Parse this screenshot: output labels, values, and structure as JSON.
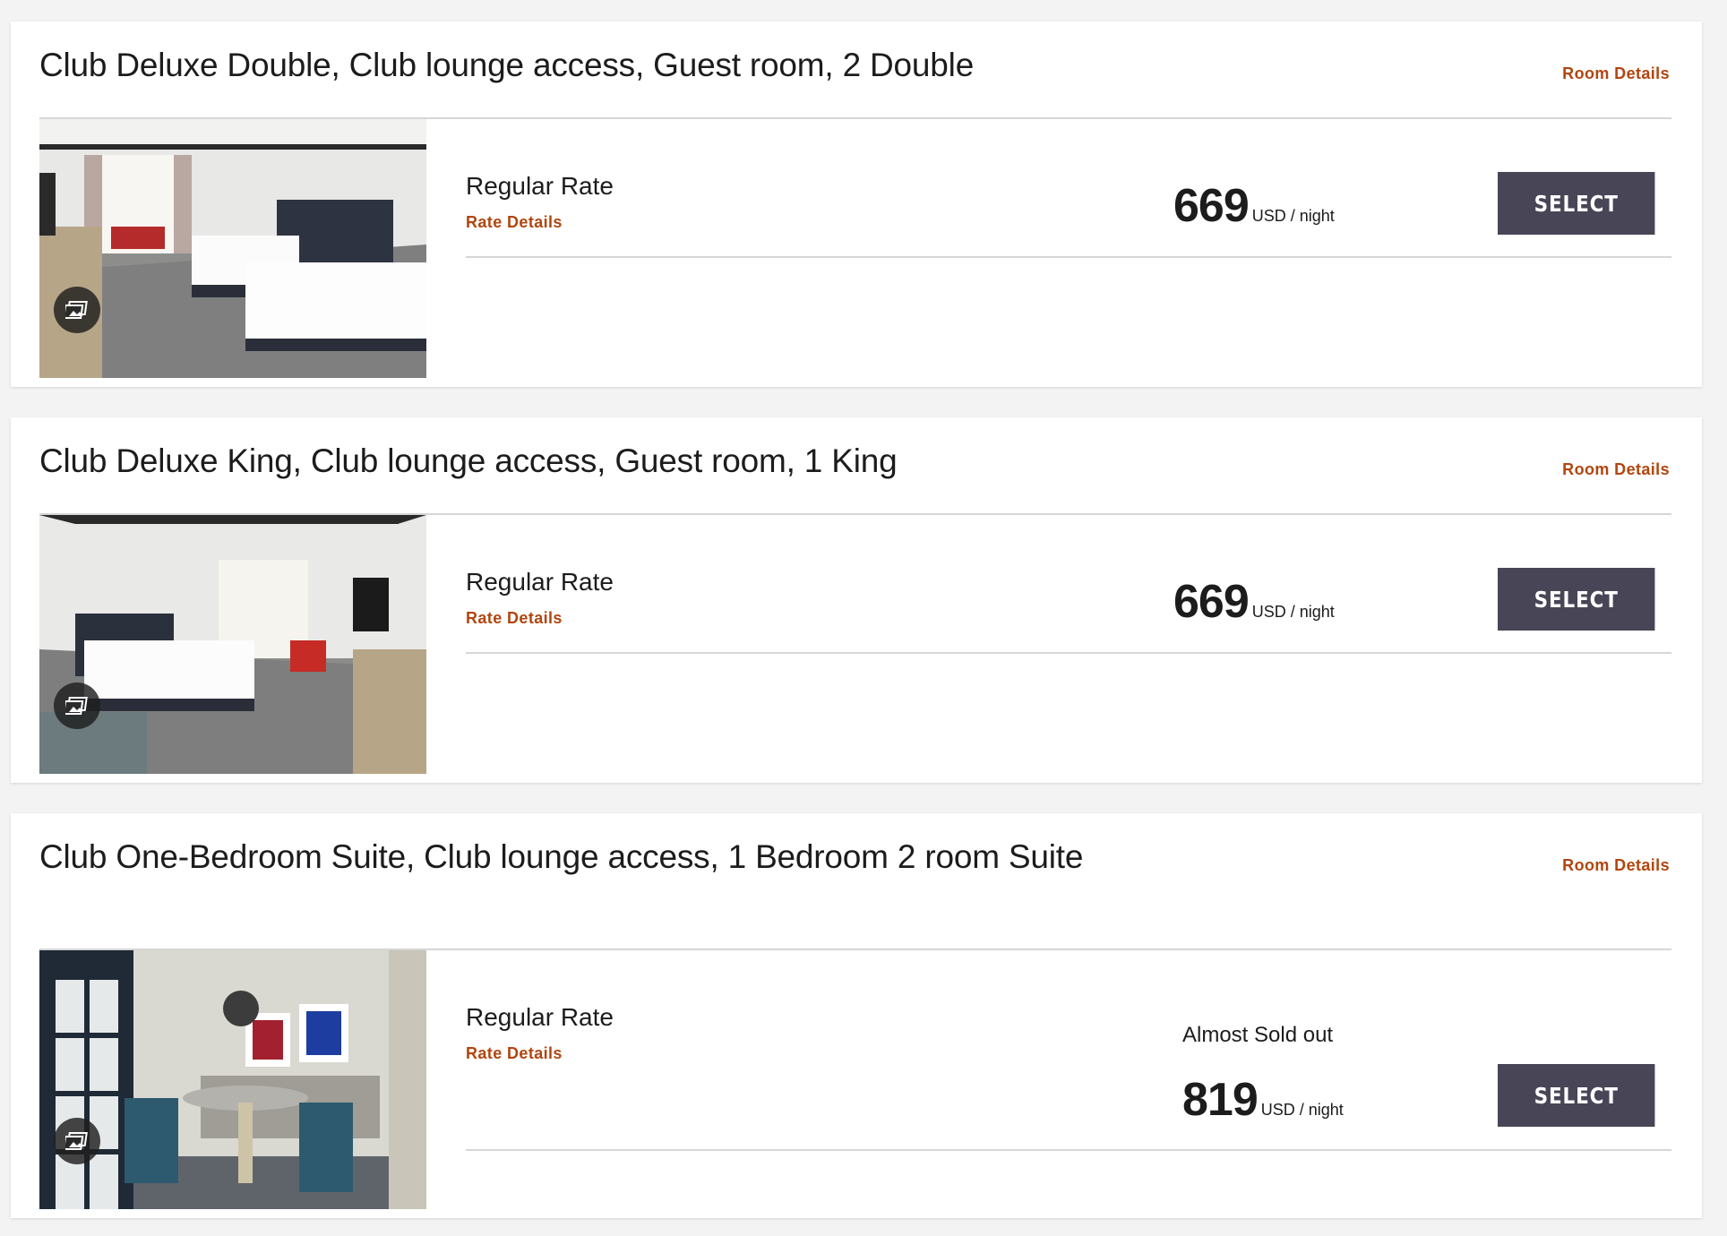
{
  "rooms": [
    {
      "title": "Club Deluxe Double, Club lounge access, Guest room, 2 Double",
      "room_details_label": "Room Details",
      "rate_name": "Regular Rate",
      "rate_details_label": "Rate Details",
      "availability_note": "",
      "price": "669",
      "price_unit": "USD / night",
      "select_label": "SELECT",
      "photo_icon": "gallery-icon"
    },
    {
      "title": "Club Deluxe King, Club lounge access, Guest room, 1 King",
      "room_details_label": "Room Details",
      "rate_name": "Regular Rate",
      "rate_details_label": "Rate Details",
      "availability_note": "",
      "price": "669",
      "price_unit": "USD / night",
      "select_label": "SELECT",
      "photo_icon": "gallery-icon"
    },
    {
      "title": "Club One-Bedroom Suite, Club lounge access, 1 Bedroom 2 room Suite",
      "room_details_label": "Room Details",
      "rate_name": "Regular Rate",
      "rate_details_label": "Rate Details",
      "availability_note": "Almost Sold out",
      "price": "819",
      "price_unit": "USD / night",
      "select_label": "SELECT",
      "photo_icon": "gallery-icon"
    }
  ],
  "colors": {
    "accent_link": "#b1460f",
    "button_bg": "#474556",
    "page_bg": "#f3f3f3",
    "card_bg": "#ffffff"
  }
}
